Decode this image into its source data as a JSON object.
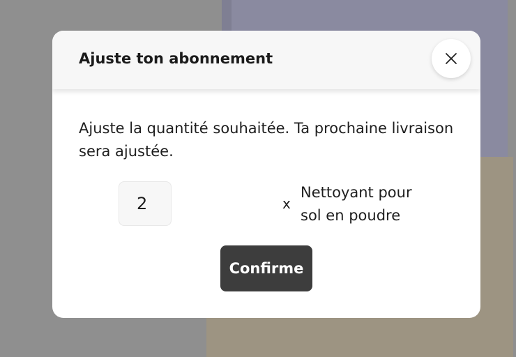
{
  "modal": {
    "title": "Ajuste ton abonnement",
    "close_icon": "close-icon",
    "description": "Ajuste la quantité souhaitée. Ta prochaine livraison sera ajustée.",
    "quantity": "2",
    "times_sign": "x",
    "product_name": "Nettoyant pour sol en poudre",
    "confirm_label": "Confirme"
  },
  "colors": {
    "overlay": "#8f8f8f",
    "header_bg": "#f7f7f7",
    "button_bg": "#3d3d3d",
    "text": "#1e1e1e"
  }
}
